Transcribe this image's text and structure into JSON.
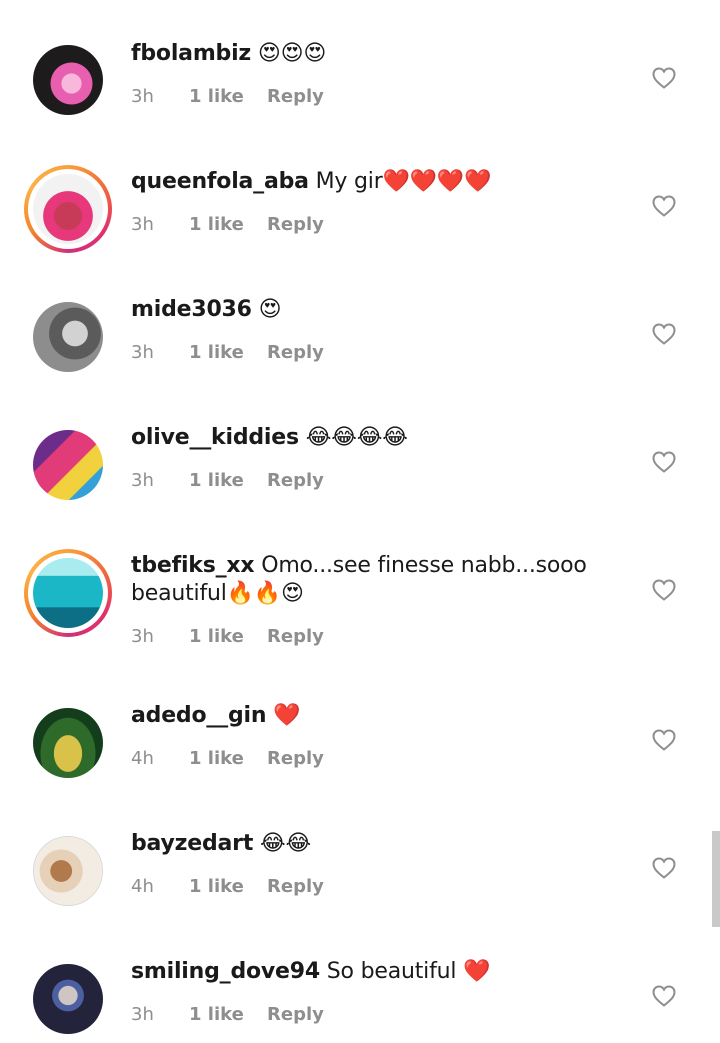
{
  "comments": [
    {
      "username": "fbolambiz",
      "text": " ",
      "emoji": "😍😍😍",
      "time": "3h",
      "likes": "1 like",
      "reply": "Reply",
      "story": false,
      "avatar_colors": [
        "#1d1b1c",
        "#e85fb0",
        "#f7b8dc"
      ]
    },
    {
      "username": "queenfola_aba",
      "text": " My gir",
      "emoji": "❤️❤️❤️❤️",
      "time": "3h",
      "likes": "1 like",
      "reply": "Reply",
      "story": true,
      "avatar_colors": [
        "#f2f2f2",
        "#e8387c",
        "#c73b58"
      ]
    },
    {
      "username": "mide3036",
      "text": " ",
      "emoji": "😍",
      "time": "3h",
      "likes": "1 like",
      "reply": "Reply",
      "story": false,
      "avatar_colors": [
        "#8d8d8d",
        "#5b5b5b",
        "#d2d2d2"
      ]
    },
    {
      "username": "olive__kiddies",
      "text": " ",
      "emoji": "😂😂😂😂",
      "time": "3h",
      "likes": "1 like",
      "reply": "Reply",
      "story": false,
      "avatar_colors": [
        "#6c2c8a",
        "#e23b7a",
        "#f2d23c"
      ]
    },
    {
      "username": "tbefiks_xx",
      "text": " Omo...see finesse nabb...sooo beautiful",
      "emoji": "🔥🔥😍",
      "time": "3h",
      "likes": "1 like",
      "reply": "Reply",
      "story": true,
      "avatar_colors": [
        "#1bb7c7",
        "#76dbe0",
        "#0c6f86"
      ]
    },
    {
      "username": "adedo__gin",
      "text": " ",
      "emoji": "❤️",
      "time": "4h",
      "likes": "1 like",
      "reply": "Reply",
      "story": false,
      "avatar_colors": [
        "#143d1c",
        "#d9c24a",
        "#2e6b2a"
      ]
    },
    {
      "username": "bayzedart",
      "text": " ",
      "emoji": "😂😂",
      "time": "4h",
      "likes": "1 like",
      "reply": "Reply",
      "story": false,
      "avatar_colors": [
        "#f2ece3",
        "#b07a4d",
        "#e6d1b8"
      ]
    },
    {
      "username": "smiling_dove94",
      "text": " So beautiful ",
      "emoji": "❤️",
      "time": "3h",
      "likes": "1 like",
      "reply": "Reply",
      "story": false,
      "avatar_colors": [
        "#23233b",
        "#4b5fa1",
        "#cfc6c3"
      ]
    }
  ],
  "heart_icon": "heart-outline-icon",
  "colors": {
    "text": "#1a1a1a",
    "meta": "#8e8e8e",
    "story_ring": "#e1306c"
  }
}
